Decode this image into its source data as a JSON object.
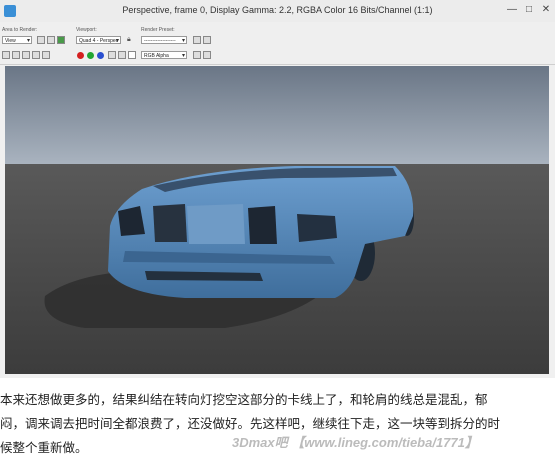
{
  "window": {
    "title": "Perspective, frame 0, Display Gamma: 2.2, RGBA Color 16 Bits/Channel (1:1)",
    "min_glyph": "—",
    "max_glyph": "□",
    "close_glyph": "✕"
  },
  "toolbar": {
    "area_label": "Area to Render:",
    "area_value": "View",
    "viewport_label": "Viewport:",
    "viewport_value": "Quad 4 - Perspec",
    "preset_label": "Render Preset:",
    "preset_value": "-------------------",
    "channel_value": "RGB Alpha",
    "channel_colors": {
      "red": "#d42020",
      "green": "#22a532",
      "blue": "#2a4fd0"
    }
  },
  "scene": {
    "model": "car-body",
    "colors": {
      "sky": "#8a98a8",
      "ground": "#474747",
      "car": "#4d7fb0"
    }
  },
  "caption": {
    "line1": "本来还想做更多的，结果纠结在转向灯挖空这部分的卡线上了，和轮肩的线总是混乱，郁",
    "line2": "闷，调来调去把时间全都浪费了，还没做好。先这样吧，继续往下走，这一块等到拆分的时",
    "line3": "候整个重新做。"
  },
  "watermark": "3Dmax吧 【www.lineg.com/tieba/1771】"
}
